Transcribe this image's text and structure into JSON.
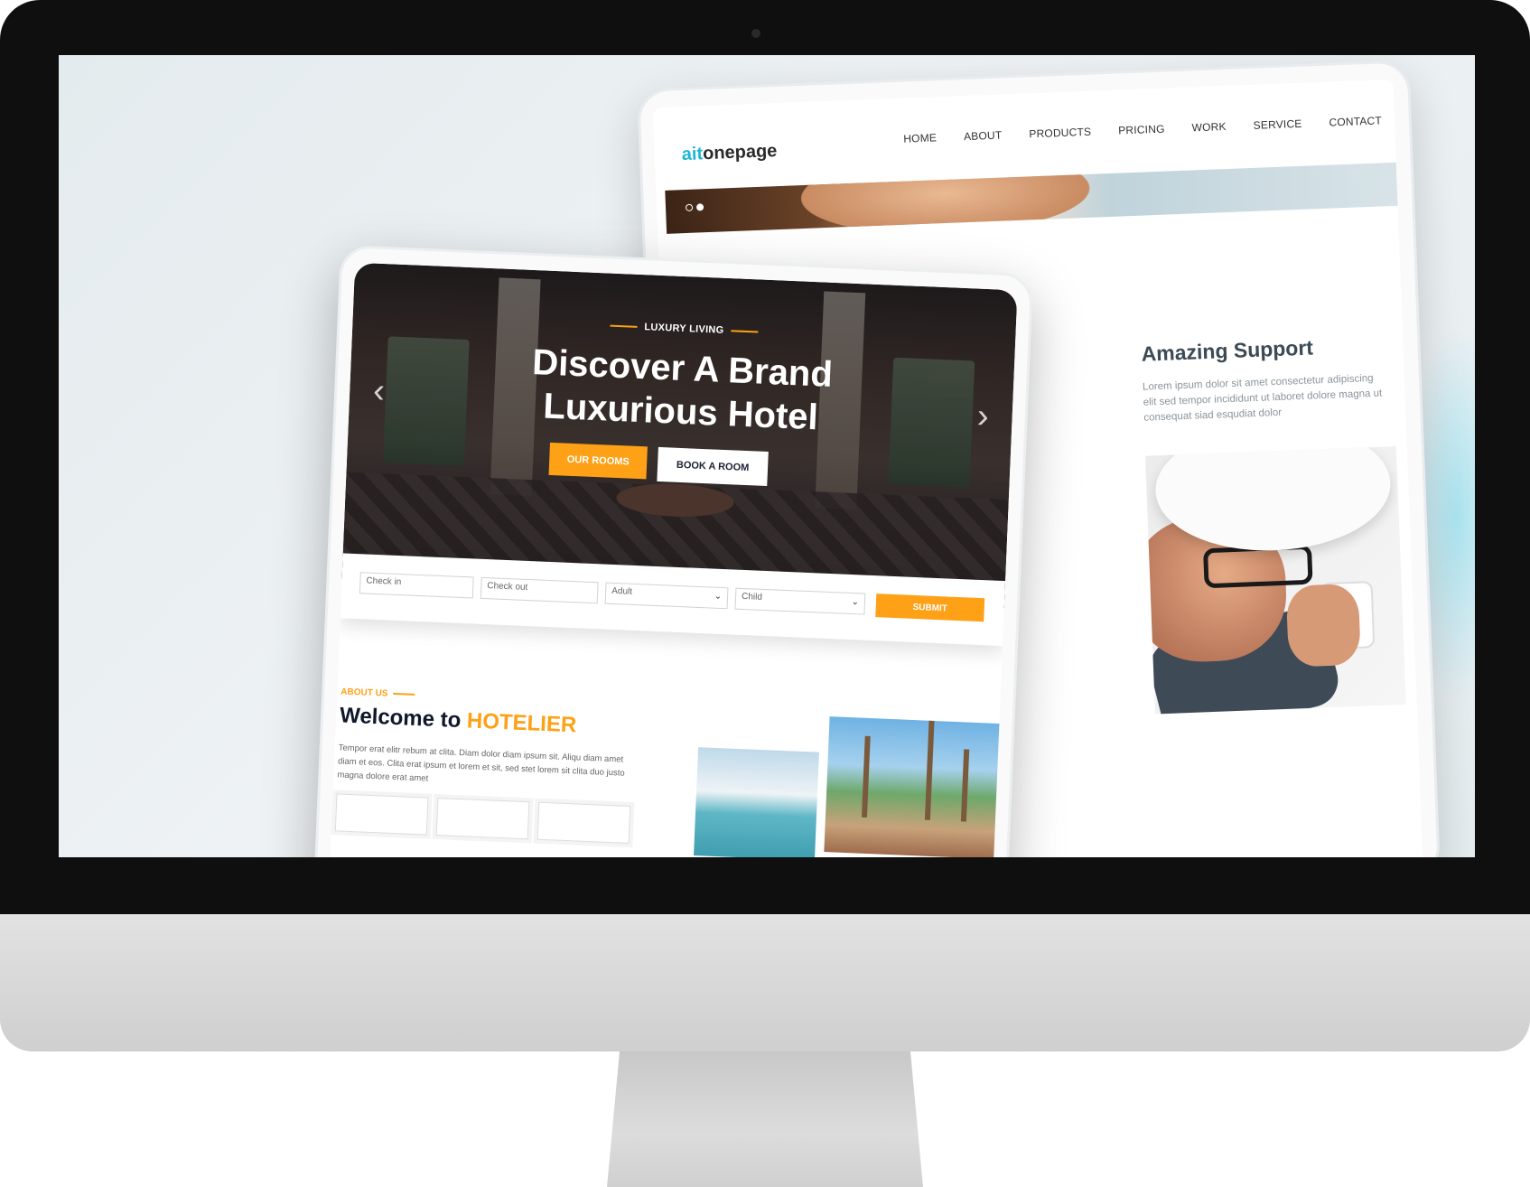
{
  "back_site": {
    "logo_prefix": "ait",
    "logo_suffix": "onepage",
    "nav": [
      "HOME",
      "ABOUT",
      "PRODUCTS",
      "PRICING",
      "WORK",
      "SERVICE",
      "CONTACT"
    ],
    "support_title": "Amazing Support",
    "support_text": "Lorem ipsum dolor sit amet consectetur adipiscing elit sed tempor incididunt ut laboret dolore magna ut consequat siad esqudiat dolor"
  },
  "front_site": {
    "tagline": "LUXURY LIVING",
    "hero_title_line1": "Discover A Brand",
    "hero_title_line2": "Luxurious Hotel",
    "arrow_prev": "‹",
    "arrow_next": "›",
    "btn_rooms": "OUR ROOMS",
    "btn_book": "BOOK A ROOM",
    "booking": {
      "checkin_placeholder": "Check in",
      "checkout_placeholder": "Check out",
      "adult_label": "Adult",
      "child_label": "Child",
      "submit_label": "SUBMIT"
    },
    "about_label": "ABOUT US",
    "welcome_prefix": "Welcome to",
    "welcome_brand": "HOTELIER",
    "about_text": "Tempor erat elitr rebum at clita. Diam dolor diam ipsum sit. Aliqu diam amet diam et eos. Clita erat ipsum et lorem et sit, sed stet lorem sit clita duo justo magna dolore erat amet"
  },
  "colors": {
    "accent_orange": "#fea116",
    "logo_blue": "#1cb5d6",
    "monitor_black": "#0f0f0f"
  }
}
